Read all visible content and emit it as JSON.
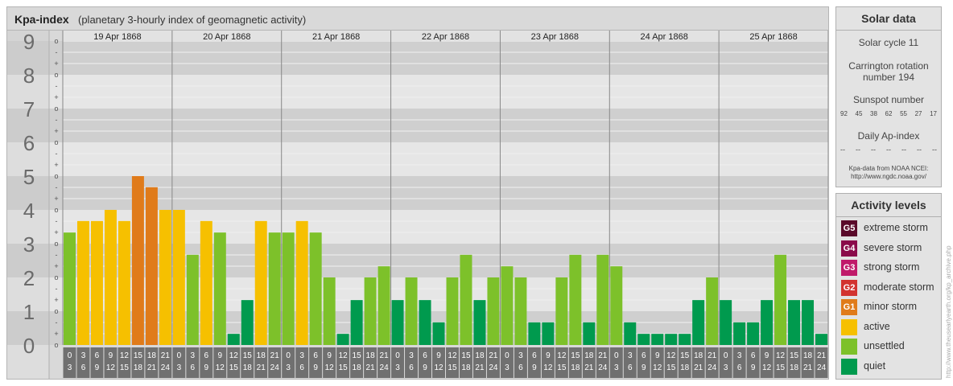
{
  "title": {
    "main": "Kpa-index",
    "sub": "(planetary 3-hourly index of geomagnetic activity)"
  },
  "chart_data": {
    "type": "bar",
    "ylim": [
      0,
      9
    ],
    "y_ticks": [
      "0",
      "1",
      "2",
      "3",
      "4",
      "5",
      "6",
      "7",
      "8",
      "9"
    ],
    "minor_ticks": [
      "o",
      "+",
      "-"
    ],
    "days": [
      "19 Apr 1868",
      "20 Apr 1868",
      "21 Apr 1868",
      "22 Apr 1868",
      "23 Apr 1868",
      "24 Apr 1868",
      "25 Apr 1868"
    ],
    "interval_start": [
      "0",
      "3",
      "6",
      "9",
      "12",
      "15",
      "18",
      "21"
    ],
    "interval_end": [
      "3",
      "6",
      "9",
      "12",
      "15",
      "18",
      "21",
      "24"
    ],
    "values": [
      3.33,
      3.67,
      3.67,
      4.0,
      3.67,
      5.0,
      4.67,
      4.0,
      4.0,
      2.67,
      3.67,
      3.33,
      0.33,
      1.33,
      3.67,
      3.33,
      3.33,
      3.67,
      3.33,
      2.0,
      0.33,
      1.33,
      2.0,
      2.33,
      1.33,
      2.0,
      1.33,
      0.67,
      2.0,
      2.67,
      1.33,
      2.0,
      2.33,
      2.0,
      0.67,
      0.67,
      2.0,
      2.67,
      0.67,
      2.67,
      2.33,
      0.67,
      0.33,
      0.33,
      0.33,
      0.33,
      1.33,
      2.0,
      1.33,
      0.67,
      0.67,
      1.33,
      2.67,
      1.33,
      1.33,
      0.33
    ],
    "colors": {
      "minor storm": "#e07b1a",
      "active": "#f6c000",
      "unsettled": "#7dc12a",
      "quiet": "#009a4e"
    }
  },
  "solar": {
    "title": "Solar data",
    "cycle": "Solar cycle 11",
    "carrington_line1": "Carrington rotation",
    "carrington_line2": "number 194",
    "sunspot_title": "Sunspot number",
    "sunspot_values": [
      "92",
      "45",
      "38",
      "62",
      "55",
      "27",
      "17"
    ],
    "ap_title": "Daily Ap-index",
    "ap_values": [
      "--",
      "--",
      "--",
      "--",
      "--",
      "--",
      "--"
    ],
    "source_line1": "Kpa-data from NOAA NCEI:",
    "source_line2": "http://www.ngdc.noaa.gov/"
  },
  "activity": {
    "title": "Activity levels",
    "levels": [
      {
        "badge": "G5",
        "label": "extreme storm",
        "color": "#5a0a2a"
      },
      {
        "badge": "G4",
        "label": "severe storm",
        "color": "#8a0a4a"
      },
      {
        "badge": "G3",
        "label": "strong storm",
        "color": "#c01a6a"
      },
      {
        "badge": "G2",
        "label": "moderate storm",
        "color": "#d2332f"
      },
      {
        "badge": "G1",
        "label": "minor storm",
        "color": "#e07b1a"
      },
      {
        "badge": "",
        "label": "active",
        "color": "#f6c000"
      },
      {
        "badge": "",
        "label": "unsettled",
        "color": "#7dc12a"
      },
      {
        "badge": "",
        "label": "quiet",
        "color": "#009a4e"
      }
    ]
  },
  "credit": "http://www.theusearlyearth.org/kp_archive.php"
}
